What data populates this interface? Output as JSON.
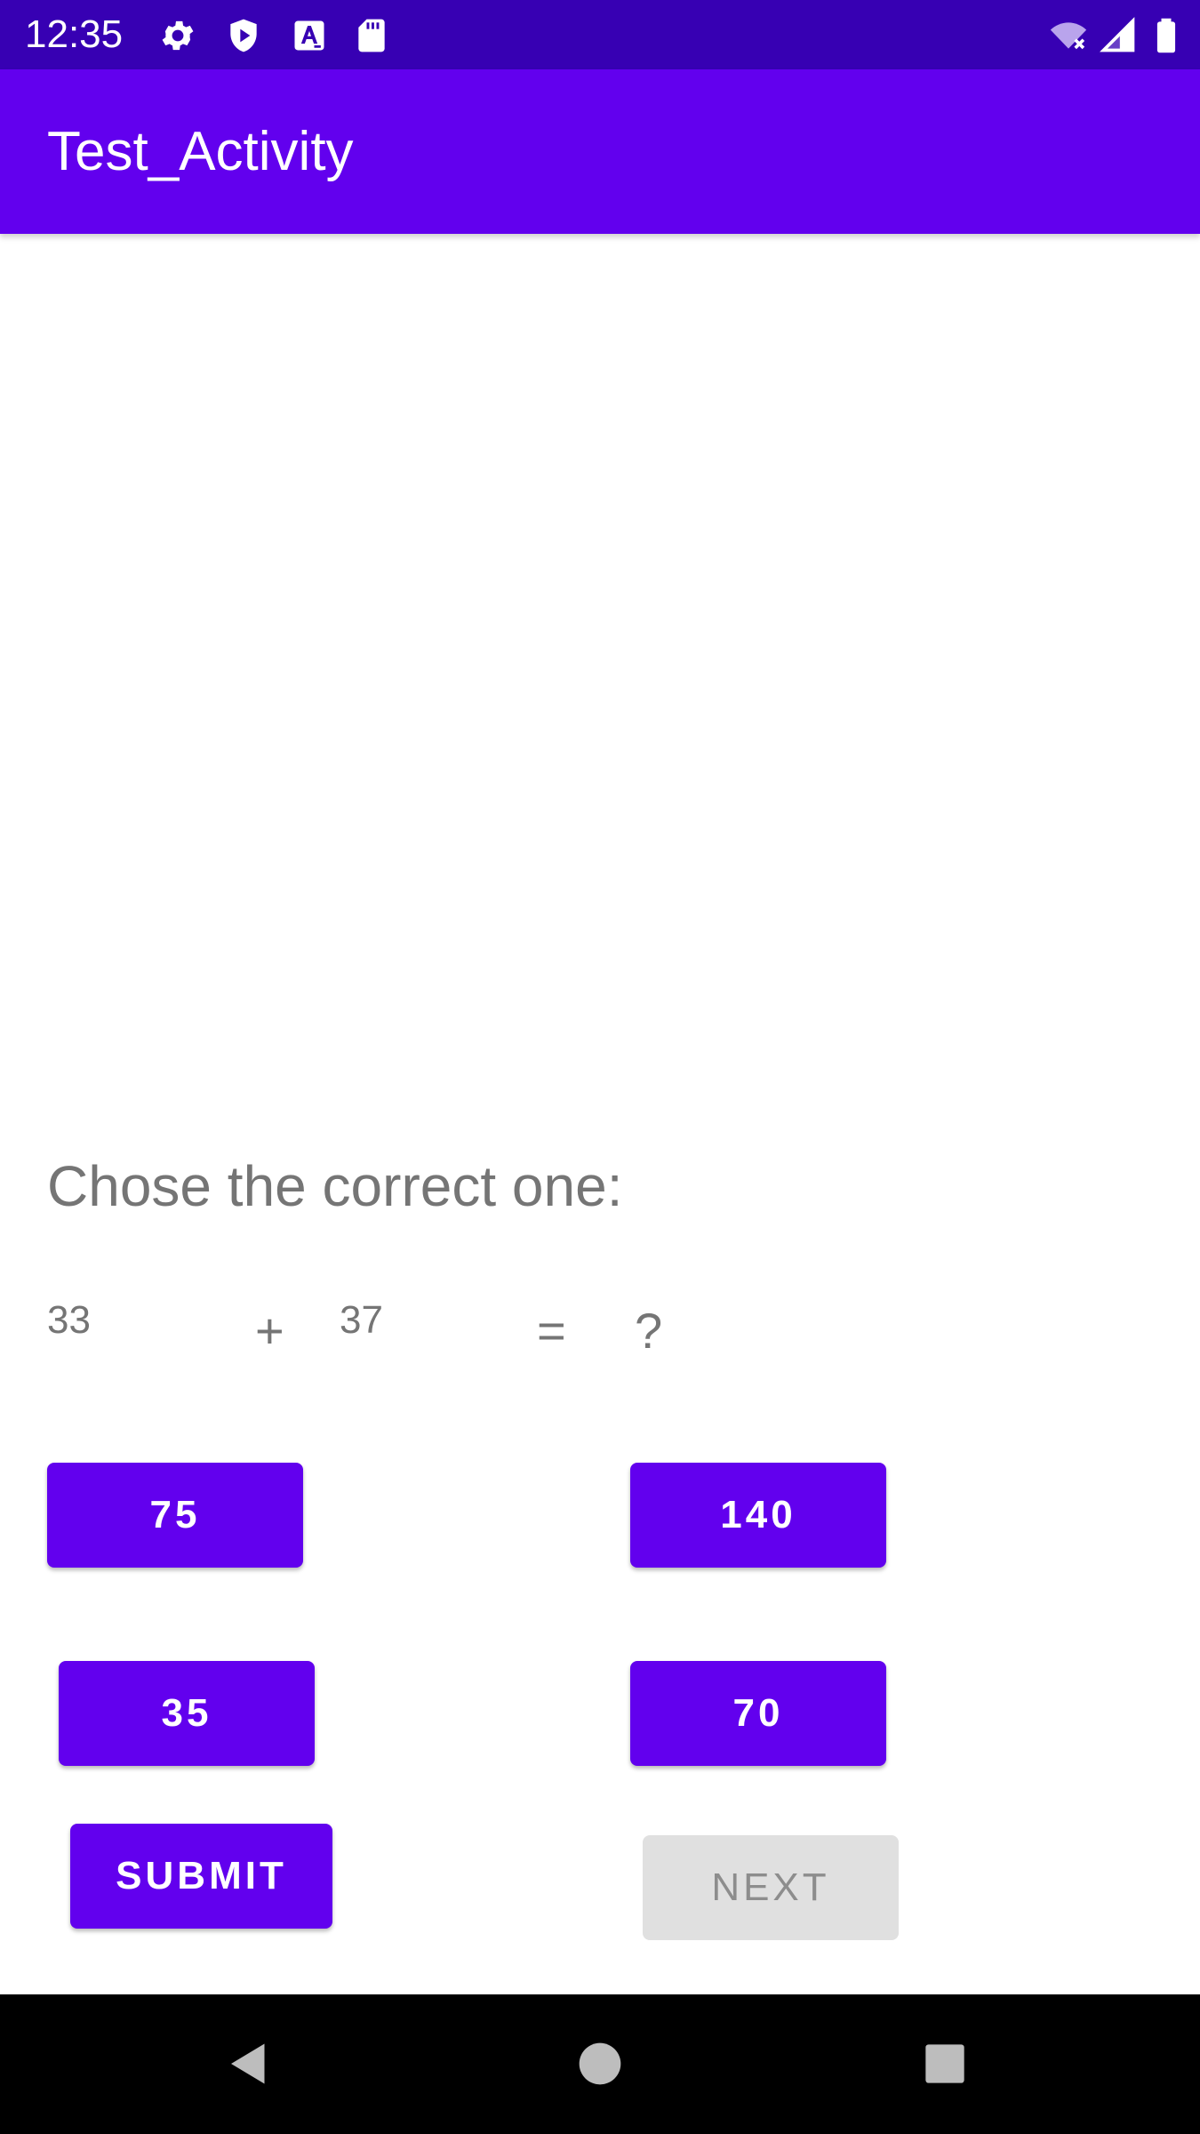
{
  "status_bar": {
    "time": "12:35",
    "icons": [
      "settings-icon",
      "shield-play-icon",
      "font-a-icon",
      "sd-card-icon",
      "wifi-off-icon",
      "signal-icon",
      "battery-icon"
    ],
    "background": "#3700b3"
  },
  "app_bar": {
    "title": "Test_Activity",
    "background": "#6200ee"
  },
  "quiz": {
    "prompt": "Chose the correct one:",
    "operand_a": "33",
    "operator": "+",
    "operand_b": "37",
    "equals": "=",
    "unknown": "?"
  },
  "options": [
    {
      "label": "75"
    },
    {
      "label": "140"
    },
    {
      "label": "35"
    },
    {
      "label": "70"
    }
  ],
  "actions": {
    "submit_label": "SUBMIT",
    "next_label": "NEXT",
    "next_enabled": false
  },
  "nav_bar": {
    "icons": [
      "back-icon",
      "home-icon",
      "recents-icon"
    ]
  },
  "colors": {
    "accent": "#6200ee",
    "text_secondary": "#757575",
    "disabled_bg": "#e0e0e0"
  }
}
